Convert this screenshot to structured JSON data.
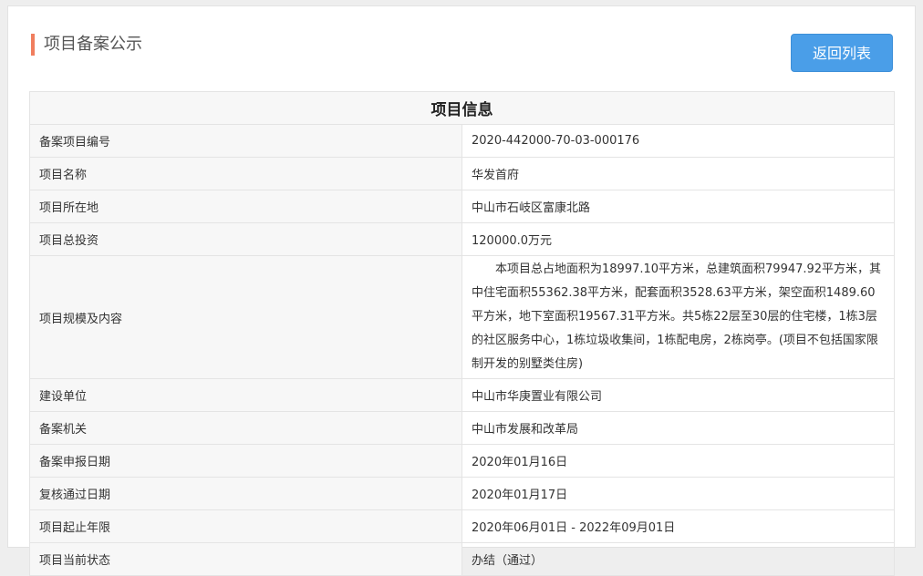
{
  "header": {
    "title": "项目备案公示",
    "back_label": "返回列表",
    "accent_color": "#f07e5e",
    "button_color": "#4a9ee8"
  },
  "table": {
    "title": "项目信息",
    "rows": [
      {
        "label": "备案项目编号",
        "value": "2020-442000-70-03-000176"
      },
      {
        "label": "项目名称",
        "value": "华发首府"
      },
      {
        "label": "项目所在地",
        "value": "中山市石岐区富康北路"
      },
      {
        "label": "项目总投资",
        "value": "120000.0万元"
      },
      {
        "label": "项目规模及内容",
        "value": "本项目总占地面积为18997.10平方米，总建筑面积79947.92平方米，其中住宅面积55362.38平方米，配套面积3528.63平方米，架空面积1489.60平方米，地下室面积19567.31平方米。共5栋22层至30层的住宅楼，1栋3层的社区服务中心，1栋垃圾收集间，1栋配电房，2栋岗亭。(项目不包括国家限制开发的别墅类住房)"
      },
      {
        "label": "建设单位",
        "value": "中山市华庚置业有限公司"
      },
      {
        "label": "备案机关",
        "value": "中山市发展和改革局"
      },
      {
        "label": "备案申报日期",
        "value": "2020年01月16日"
      },
      {
        "label": "复核通过日期",
        "value": "2020年01月17日"
      },
      {
        "label": "项目起止年限",
        "value": "2020年06月01日 - 2022年09月01日"
      },
      {
        "label": "项目当前状态",
        "value": "办结（通过）"
      }
    ]
  }
}
